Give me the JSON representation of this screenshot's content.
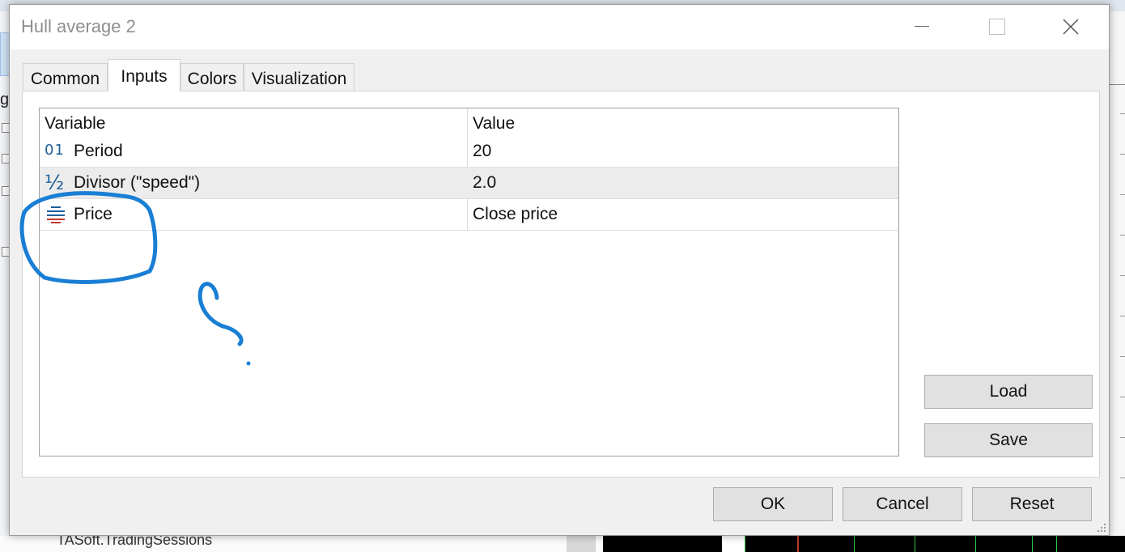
{
  "window": {
    "title": "Hull average 2"
  },
  "tabs": [
    {
      "label": "Common",
      "active": false
    },
    {
      "label": "Inputs",
      "active": true
    },
    {
      "label": "Colors",
      "active": false
    },
    {
      "label": "Visualization",
      "active": false
    }
  ],
  "grid": {
    "headers": {
      "variable": "Variable",
      "value": "Value"
    },
    "rows": [
      {
        "icon": "integer-icon",
        "icon_glyph": "01",
        "variable": "Period",
        "value": "20"
      },
      {
        "icon": "fraction-icon",
        "icon_glyph": "½",
        "variable": "Divisor (\"speed\")",
        "value": "2.0"
      },
      {
        "icon": "enum-icon",
        "icon_glyph": "",
        "variable": "Price",
        "value": "Close price"
      }
    ]
  },
  "side_buttons": {
    "load": "Load",
    "save": "Save"
  },
  "footer_buttons": {
    "ok": "OK",
    "cancel": "Cancel",
    "reset": "Reset"
  },
  "background": {
    "left_panel_char": "g",
    "bottom_text": "TASoft.TradingSessions"
  },
  "colors": {
    "annotation": "#1a7fd4",
    "icon_blue": "#1e5f9a",
    "icon_red": "#c0392b"
  }
}
